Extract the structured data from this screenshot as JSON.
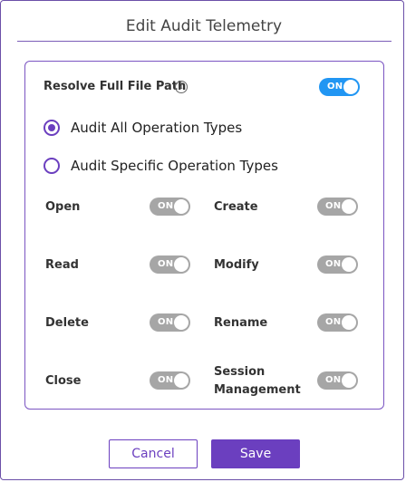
{
  "dialog": {
    "title": "Edit Audit Telemetry"
  },
  "resolve": {
    "label": "Resolve Full File Path",
    "info_icon": "i",
    "toggle_text": "ON"
  },
  "radios": {
    "all_label": "Audit All Operation Types",
    "specific_label": "Audit Specific Operation Types",
    "selected": "all"
  },
  "operations": {
    "open": "Open",
    "create": "Create",
    "read": "Read",
    "modify": "Modify",
    "delete": "Delete",
    "rename": "Rename",
    "close": "Close",
    "session_management": "Session Management",
    "toggle_text": "ON"
  },
  "buttons": {
    "cancel": "Cancel",
    "save": "Save"
  },
  "colors": {
    "accent": "#6b3fbf",
    "toggle_on_blue": "#2196f3",
    "toggle_disabled": "#a6a6a6"
  }
}
